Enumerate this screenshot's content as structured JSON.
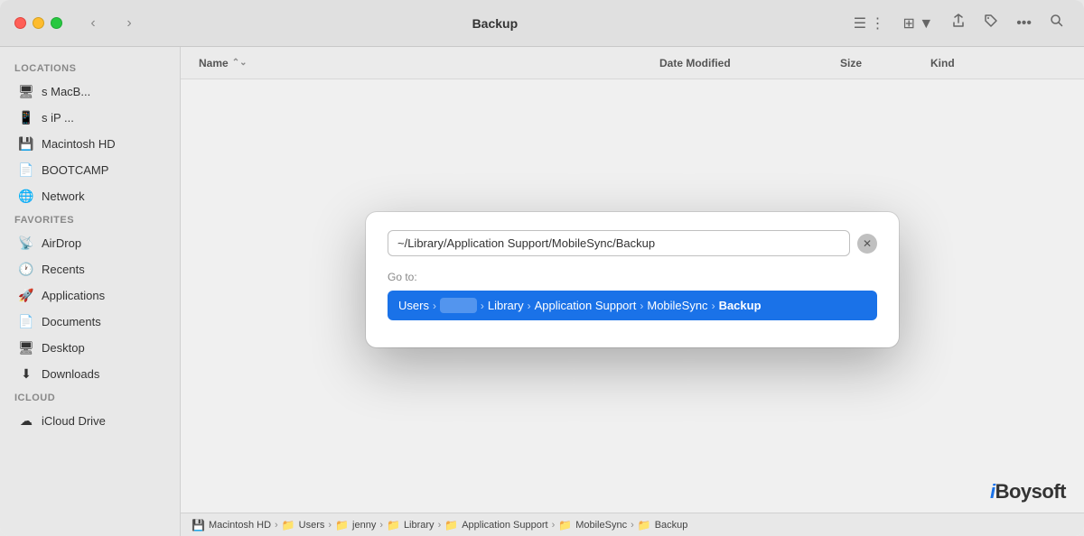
{
  "window": {
    "title": "Backup",
    "traffic_lights": {
      "red": "close",
      "yellow": "minimize",
      "green": "maximize"
    }
  },
  "toolbar": {
    "back_label": "‹",
    "forward_label": "›",
    "list_view_icon": "≡",
    "grid_view_icon": "⊞",
    "share_icon": "↑",
    "tag_icon": "◊",
    "more_icon": "•••",
    "search_icon": "🔍"
  },
  "columns": {
    "name": "Name",
    "date_modified": "Date Modified",
    "size": "Size",
    "kind": "Kind"
  },
  "sidebar": {
    "sections": [
      {
        "label": "Locations",
        "items": [
          {
            "id": "macb",
            "label": "s MacB...",
            "icon": "🖥"
          },
          {
            "id": "ip",
            "label": "s iP ...",
            "icon": "📱"
          },
          {
            "id": "macintosh-hd",
            "label": "Macintosh HD",
            "icon": "💾"
          },
          {
            "id": "bootcamp",
            "label": "BOOTCAMP",
            "icon": "📄"
          },
          {
            "id": "network",
            "label": "Network",
            "icon": "🌐"
          }
        ]
      },
      {
        "label": "Favorites",
        "items": [
          {
            "id": "airdrop",
            "label": "AirDrop",
            "icon": "📡"
          },
          {
            "id": "recents",
            "label": "Recents",
            "icon": "🕐"
          },
          {
            "id": "applications",
            "label": "Applications",
            "icon": "🚀"
          },
          {
            "id": "documents",
            "label": "Documents",
            "icon": "📄"
          },
          {
            "id": "desktop",
            "label": "Desktop",
            "icon": "🖥"
          },
          {
            "id": "downloads",
            "label": "Downloads",
            "icon": "⬇"
          }
        ]
      },
      {
        "label": "iCloud",
        "items": [
          {
            "id": "icloud-drive",
            "label": "iCloud Drive",
            "icon": "☁"
          }
        ]
      }
    ]
  },
  "dialog": {
    "input_value": "~/Library/Application Support/MobileSync/Backup",
    "goto_label": "Go to:",
    "close_icon": "✕",
    "path": {
      "items": [
        {
          "id": "users",
          "label": "Users",
          "blurred": false,
          "current": false
        },
        {
          "id": "username",
          "label": "",
          "blurred": true,
          "current": false
        },
        {
          "id": "library",
          "label": "Library",
          "blurred": false,
          "current": false
        },
        {
          "id": "application-support",
          "label": "Application Support",
          "blurred": false,
          "current": false
        },
        {
          "id": "mobilesync",
          "label": "MobileSync",
          "blurred": false,
          "current": false
        },
        {
          "id": "backup",
          "label": "Backup",
          "blurred": false,
          "current": true
        }
      ],
      "separator": "›"
    }
  },
  "statusbar": {
    "breadcrumb": [
      {
        "id": "macintosh-hd",
        "label": "Macintosh HD",
        "icon": "💾"
      },
      {
        "id": "users",
        "label": "Users",
        "icon": "📁"
      },
      {
        "id": "jenny",
        "label": "jenny",
        "icon": "📁"
      },
      {
        "id": "library",
        "label": "Library",
        "icon": "📁"
      },
      {
        "id": "application-support",
        "label": "Application Support",
        "icon": "📁"
      },
      {
        "id": "mobilesync",
        "label": "MobileSync",
        "icon": "📁"
      },
      {
        "id": "backup",
        "label": "Backup",
        "icon": "📁"
      }
    ],
    "separator": "›"
  },
  "watermark": {
    "prefix": "i",
    "suffix": "Boysoft"
  }
}
